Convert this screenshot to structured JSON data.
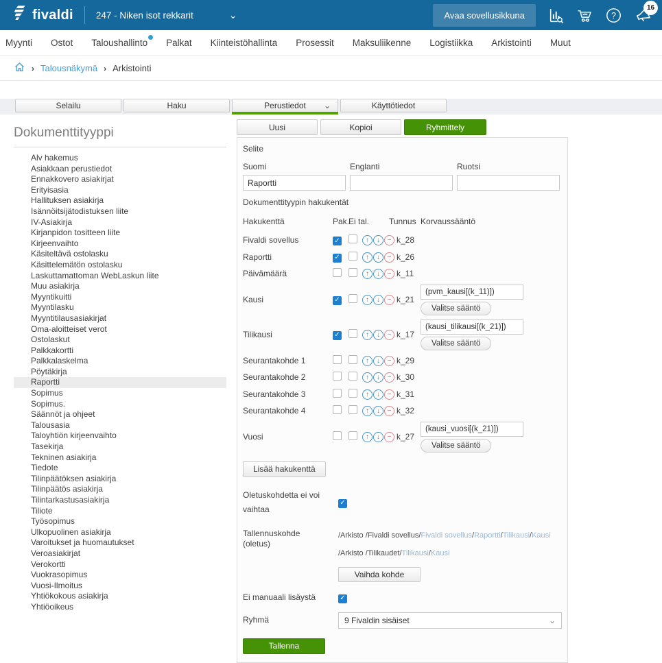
{
  "colors": {
    "topbar_blue": "#14689b",
    "accent_green": "#459206",
    "tab_underline_green": "#54a306",
    "link_blue": "#41a0d8",
    "checkbox_blue": "#1d7fd1"
  },
  "topbar": {
    "logo_text": "fivaldi",
    "company": "247 - Niken isot rekkarit",
    "open_app_button": "Avaa sovellusikkuna",
    "notification_count": "16",
    "icons": [
      "stats-search-icon",
      "cart-icon",
      "help-icon",
      "announcements-icon"
    ]
  },
  "nav": {
    "items": [
      {
        "label": "Myynti"
      },
      {
        "label": "Ostot"
      },
      {
        "label": "Taloushallinto",
        "dot": true
      },
      {
        "label": "Palkat"
      },
      {
        "label": "Kiinteistöhallinta"
      },
      {
        "label": "Prosessit"
      },
      {
        "label": "Maksuliikenne"
      },
      {
        "label": "Logistiikka"
      },
      {
        "label": "Arkistointi"
      },
      {
        "label": "Muut"
      }
    ]
  },
  "breadcrumb": {
    "links": [
      "Talousnäkymä",
      "Arkistointi"
    ]
  },
  "tabs": [
    {
      "label": "Selailu"
    },
    {
      "label": "Haku"
    },
    {
      "label": "Perustiedot",
      "active": true,
      "chevron": true
    },
    {
      "label": "Käyttötiedot"
    }
  ],
  "sidebar": {
    "title": "Dokumenttityyppi",
    "selected": "Raportti",
    "items": [
      "Alv hakemus",
      "Asiakkaan perustiedot",
      "Ennakkovero asiakirjat",
      "Erityisasia",
      "Hallituksen asiakirja",
      "Isännöitsijätodistuksen liite",
      "IV-Asiakirja",
      "Kirjanpidon tositteen liite",
      "Kirjeenvaihto",
      "Käsiteltävä ostolasku",
      "Käsittelemätön ostolasku",
      "Laskuttamattoman WebLaskun liite",
      "Muu asiakirja",
      "Myyntikuitti",
      "Myyntilasku",
      "Myyntitilausasiakirjat",
      "Oma-aloitteiset verot",
      "Ostolaskut",
      "Palkkakortti",
      "Palkkalaskelma",
      "Pöytäkirja",
      "Raportti",
      "Sopimus",
      "Sopimus.",
      "Säännöt ja ohjeet",
      "Talousasia",
      "Taloyhtiön kirjeenvaihto",
      "Tasekirja",
      "Tekninen asiakirja",
      "Tiedote",
      "Tilinpäätöksen asiakirja",
      "Tilinpäätös asiakirja",
      "Tilintarkastusasiakirja",
      "Tiliote",
      "Työsopimus",
      "Ulkopuolinen asiakirja",
      "Varoitukset ja huomautukset",
      "Veroasiakirjat",
      "Verokortti",
      "Vuokrasopimus",
      "Vuosi-Ilmoitus",
      "Yhtiökokous asiakirja",
      "Yhtiöoikeus"
    ]
  },
  "actions": {
    "new_label": "Uusi",
    "copy_label": "Kopioi",
    "grouping_label": "Ryhmittely"
  },
  "form": {
    "selite_label": "Selite",
    "languages": [
      {
        "label": "Suomi",
        "value": "Raportti"
      },
      {
        "label": "Englanti",
        "value": ""
      },
      {
        "label": "Ruotsi",
        "value": ""
      }
    ],
    "search_fields_title": "Dokumenttityypin hakukentät",
    "table_headers": {
      "field": "Hakukenttä",
      "mandatory": "Pak.",
      "not_stored": "Ei tal.",
      "code": "Tunnus",
      "replacement_rule": "Korvaussääntö"
    },
    "rows": [
      {
        "name": "Fivaldi sovellus",
        "mandatory": true,
        "not_stored": false,
        "code": "k_28",
        "rule": null
      },
      {
        "name": "Raportti",
        "mandatory": true,
        "not_stored": false,
        "code": "k_26",
        "rule": null
      },
      {
        "name": "Päivämäärä",
        "mandatory": false,
        "not_stored": false,
        "code": "k_11",
        "rule": null
      },
      {
        "name": "Kausi",
        "mandatory": true,
        "not_stored": false,
        "code": "k_21",
        "rule": "(pvm_kausi[(k_11)])"
      },
      {
        "name": "Tilikausi",
        "mandatory": true,
        "not_stored": false,
        "code": "k_17",
        "rule": "(kausi_tilikausi[(k_21)])"
      },
      {
        "name": "Seurantakohde 1",
        "mandatory": false,
        "not_stored": false,
        "code": "k_29",
        "rule": null
      },
      {
        "name": "Seurantakohde 2",
        "mandatory": false,
        "not_stored": false,
        "code": "k_30",
        "rule": null
      },
      {
        "name": "Seurantakohde 3",
        "mandatory": false,
        "not_stored": false,
        "code": "k_31",
        "rule": null
      },
      {
        "name": "Seurantakohde 4",
        "mandatory": false,
        "not_stored": false,
        "code": "k_32",
        "rule": null
      },
      {
        "name": "Vuosi",
        "mandatory": false,
        "not_stored": false,
        "code": "k_27",
        "rule": "(kausi_vuosi[(k_21)])"
      }
    ],
    "select_rule_button": "Valitse sääntö",
    "add_field_button": "Lisää hakukenttä",
    "default_target_locked_label": "Oletuskohdetta ei voi vaihtaa",
    "default_target_locked_checked": true,
    "storage_target_label": "Tallennuskohde (oletus)",
    "storage_paths": [
      {
        "segments": [
          {
            "text": "/Arkisto /Fivaldi sovellus/",
            "link": false
          },
          {
            "text": "Fivaldi sovellus",
            "link": true
          },
          {
            "text": "/",
            "link": false
          },
          {
            "text": "Raportti",
            "link": true
          },
          {
            "text": "/",
            "link": false
          },
          {
            "text": "Tilikausi",
            "link": true
          },
          {
            "text": "/",
            "link": false
          },
          {
            "text": "Kausi",
            "link": true
          }
        ]
      },
      {
        "segments": [
          {
            "text": "/Arkisto /Tilikaudet/",
            "link": false
          },
          {
            "text": "Tilikausi",
            "link": true
          },
          {
            "text": "/",
            "link": false
          },
          {
            "text": "Kausi",
            "link": true
          }
        ]
      }
    ],
    "change_target_button": "Vaihda kohde",
    "no_manual_add_label": "Ei manuaali lisäystä",
    "no_manual_add_checked": true,
    "group_label": "Ryhmä",
    "group_value": "9 Fivaldin sisäiset",
    "save_button": "Tallenna"
  }
}
